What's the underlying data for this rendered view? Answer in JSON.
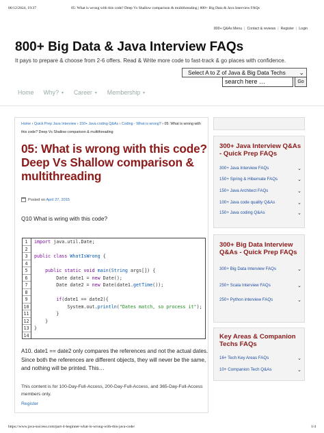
{
  "print_header": {
    "date": "06/12/2024, 19:37",
    "title": "05: What is wrong with this code? Deep Vs Shallow comparison & multithreading | 800+ Big Data & Java Interview FAQs"
  },
  "top_links": [
    "800+ Q&As Menu",
    "Contact & reviews",
    "Register",
    "Login"
  ],
  "site": {
    "title": "800+ Big Data & Java Interview FAQs",
    "tagline": "It pays to prepare & choose from 2-6 offers. Read & Write more code to fast-track & go places with confidence."
  },
  "category_select": {
    "selected": "Select A to Z of Java & Big Data Techs"
  },
  "search": {
    "placeholder": "search here …",
    "go_label": "Go"
  },
  "main_nav": [
    {
      "label": "Home",
      "has_caret": false
    },
    {
      "label": "Why?",
      "has_caret": true
    },
    {
      "label": "Career",
      "has_caret": true
    },
    {
      "label": "Membership",
      "has_caret": true
    }
  ],
  "breadcrumb": {
    "links": [
      "Home",
      "Quick Prep Java Interview",
      "150+ Java coding Q&As",
      "Coding - What is wrong?"
    ],
    "separator": " › ",
    "current": "05: What is wrong with this code? Deep Vs Shallow comparison & multithreading"
  },
  "article": {
    "title": "05: What is wrong with this code? Deep Vs Shallow comparison & multithreading",
    "posted_prefix": "Posted on",
    "posted_date": "April 27, 2015",
    "question": "Q10 What is wring with this code?",
    "answer": "A10. date1 == date2 only compares the references and not the actual dates. Since both the references are different objects, they will never be the same, and nothing will be printed. This…",
    "access_note": "This content is for 100-Day-Full-Access, 200-Day-Full-Access, and 365-Day-Full-Access members only.",
    "register_link": "Register"
  },
  "code_lines": [
    "import java.util.Date;",
    "",
    "public class WhatIsWrong {",
    "",
    "    public static void main(String args[]) {",
    "        Date date1 = new Date();",
    "        Date date2 = new Date(date1.getTime());",
    "",
    "        if(date1 == date2){",
    "            System.out.println(\"Dates match, so process it\");",
    "        }",
    "    }",
    "}",
    "",
    ""
  ],
  "sidebar": {
    "sections": [
      {
        "heading": "300+ Java Interview Q&As - Quick Prep FAQs",
        "items": [
          "300+ Java Interview FAQs",
          "150+ Spring & Hibernate FAQs",
          "150+ Java Architect FAQs",
          "100+ Java code quality Q&As",
          "150+ Java coding Q&As"
        ]
      },
      {
        "heading": "300+ Big Data Interview Q&As - Quick Prep FAQs",
        "items": [
          "300+ Big Data Interview FAQs",
          "250+ Scala Interview FAQs",
          "250+ Python interview FAQs"
        ]
      },
      {
        "heading": "Key Areas & Companion Techs FAQs",
        "items": [
          "16+ Tech Key Areas FAQs",
          "10+ Companion Tech Q&As"
        ]
      }
    ]
  },
  "print_footer": {
    "url": "https://www.java-success.com/part-4-beginner-what-is-wrong-with-this-java-code/",
    "page": "1/4"
  },
  "colors": {
    "title_red": "#8b1a1a",
    "link_blue": "#2a6ebb",
    "sidebar_link": "#1f4fa0",
    "nav_gray": "#99aaaa"
  }
}
